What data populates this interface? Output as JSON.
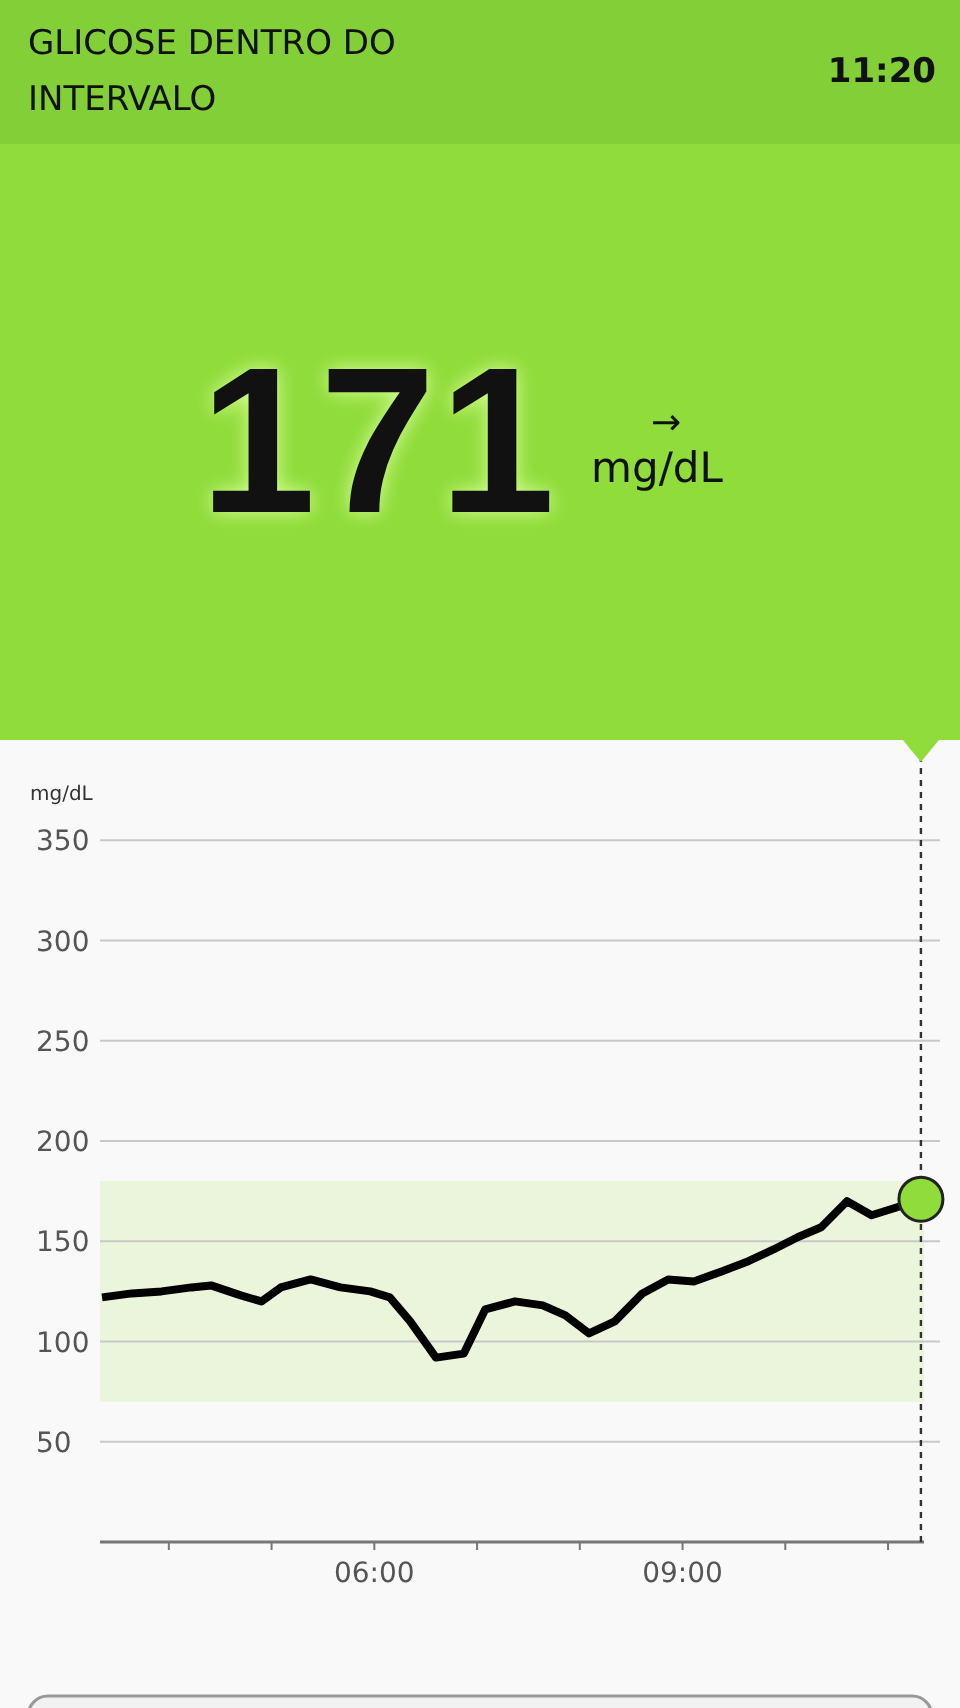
{
  "header": {
    "title": "GLICOSE DENTRO DO INTERVALO",
    "time": "11:20"
  },
  "reading": {
    "value": "171",
    "trend_arrow": "→",
    "unit": "mg/dL"
  },
  "chart": {
    "chart_data": {
      "type": "line",
      "ylabel": "mg/dL",
      "xlim": [
        3.33,
        11.35
      ],
      "ylim": [
        0,
        400
      ],
      "yticks": [
        50,
        100,
        150,
        200,
        250,
        300,
        350
      ],
      "xticks": [
        {
          "value": 6,
          "label": "06:00"
        },
        {
          "value": 9,
          "label": "09:00"
        }
      ],
      "x": [
        3.35,
        3.64,
        3.93,
        4.22,
        4.41,
        4.7,
        4.9,
        5.09,
        5.38,
        5.67,
        5.96,
        6.15,
        6.35,
        6.6,
        6.87,
        7.08,
        7.37,
        7.64,
        7.86,
        8.09,
        8.34,
        8.61,
        8.86,
        9.11,
        9.38,
        9.64,
        9.89,
        10.12,
        10.35,
        10.6,
        10.84,
        11.09,
        11.32
      ],
      "grid": true,
      "series": [
        {
          "color": "#000000",
          "values": [
            122,
            124,
            125,
            127,
            128,
            123,
            120,
            127,
            131,
            127,
            125,
            122,
            110,
            92,
            94,
            116,
            120,
            118,
            113,
            104,
            110,
            124,
            131,
            130,
            135,
            140,
            146,
            152,
            157,
            170,
            163,
            167,
            171
          ]
        }
      ],
      "bands": [
        {
          "axis": "y",
          "from": 70,
          "to": 180,
          "color": "#eaf5dc"
        }
      ]
    }
  }
}
